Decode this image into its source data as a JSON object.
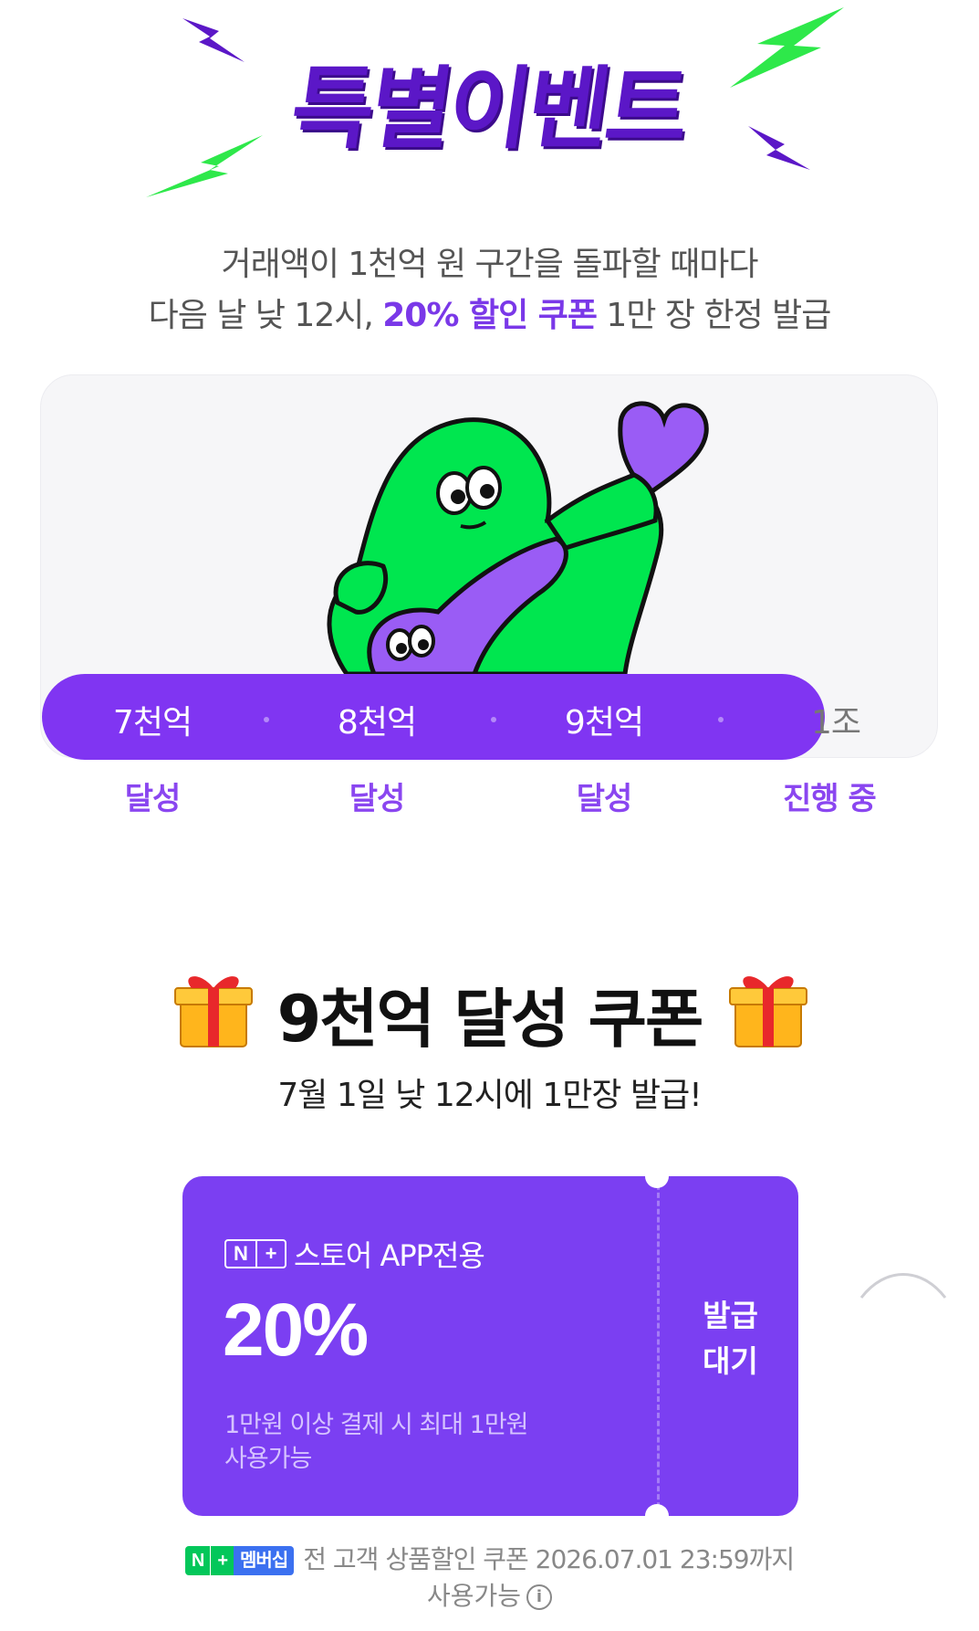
{
  "header": {
    "title": "특별이벤트",
    "description_line1": "거래액이 1천억 원 구간을 돌파할 때마다",
    "description_line2_prefix": "다음 날 낮 12시, ",
    "description_line2_highlight": "20% 할인 쿠폰",
    "description_line2_suffix": " 1만 장 한정 발급"
  },
  "progress": {
    "milestones": [
      {
        "label": "7천억",
        "status": "달성"
      },
      {
        "label": "8천억",
        "status": "달성"
      },
      {
        "label": "9천억",
        "status": "달성"
      },
      {
        "label": "1조",
        "status": "진행 중"
      }
    ],
    "fill_fraction": 0.87
  },
  "coupon_section": {
    "title": "9천억 달성 쿠폰",
    "subtitle": "7월 1일 낮 12시에 1만장 발급!",
    "coupon": {
      "logo_n": "N",
      "logo_plus": "+",
      "store_label": "스토어 APP전용",
      "discount": "20%",
      "condition_line1": "1만원 이상 결제 시 최대 1만원",
      "condition_line2": "사용가능",
      "status_line1": "발급",
      "status_line2": "대기"
    },
    "footer": {
      "badge_n": "N",
      "badge_plus": "+",
      "badge_member": "멤버십",
      "text": "전 고객 상품할인 쿠폰 2026.07.01 23:59까지",
      "text2": "사용가능",
      "info_icon": "i"
    }
  },
  "colors": {
    "brand_purple": "#7b3ff2",
    "bar_purple": "#8035f2",
    "title_purple": "#5b17c7",
    "mascot_green": "#00e64f",
    "bolt_green": "#2ee84a",
    "naver_green": "#03c75a"
  },
  "icons": [
    "lightning-bolt-icon",
    "heart-icon",
    "gift-box-icon",
    "info-icon"
  ]
}
